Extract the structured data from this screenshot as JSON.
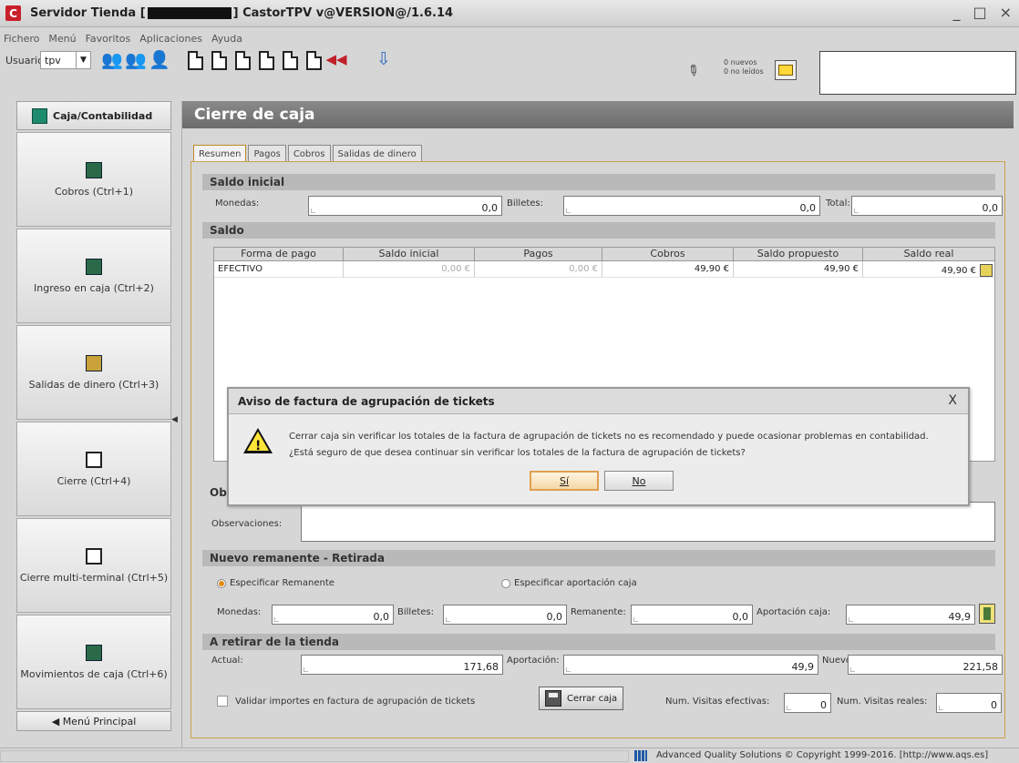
{
  "window": {
    "title_prefix": "Servidor Tienda [",
    "title_suffix": "] CastorTPV v@VERSION@/1.6.14",
    "controls": {
      "minimize": "_",
      "maximize": "□",
      "close": "×"
    }
  },
  "menu": [
    "Fichero",
    "Menú",
    "Favoritos",
    "Aplicaciones",
    "Ayuda"
  ],
  "toolbar": {
    "user_label": "Usuario:",
    "user_value": "tpv",
    "messages_line1": "0 nuevos",
    "messages_line2": "0 no leídos"
  },
  "sidebar": {
    "header": "Caja/Contabilidad",
    "items": [
      {
        "label": "Cobros (Ctrl+1)"
      },
      {
        "label": "Ingreso en caja (Ctrl+2)"
      },
      {
        "label": "Salidas de dinero (Ctrl+3)"
      },
      {
        "label": "Cierre (Ctrl+4)"
      },
      {
        "label": "Cierre multi-terminal (Ctrl+5)"
      },
      {
        "label": "Movimientos de caja (Ctrl+6)"
      }
    ],
    "footer": "◀ Menú Principal"
  },
  "main": {
    "title": "Cierre de caja",
    "tabs": [
      "Resumen",
      "Pagos",
      "Cobros",
      "Salidas de dinero"
    ],
    "saldo_inicial": {
      "heading": "Saldo inicial",
      "monedas_label": "Monedas:",
      "monedas_value": "0,0",
      "billetes_label": "Billetes:",
      "billetes_value": "0,0",
      "total_label": "Total:",
      "total_value": "0,0"
    },
    "saldo": {
      "heading": "Saldo",
      "columns": [
        "Forma de pago",
        "Saldo inicial",
        "Pagos",
        "Cobros",
        "Saldo propuesto",
        "Saldo real"
      ],
      "rows": [
        {
          "forma": "EFECTIVO",
          "saldo_inicial": "0,00 €",
          "pagos": "0,00 €",
          "cobros": "49,90 €",
          "propuesto": "49,90 €",
          "real": "49,90 €"
        }
      ]
    },
    "observaciones": {
      "heading_partial": "Ob",
      "label": "Observaciones:"
    },
    "remanente": {
      "heading": "Nuevo remanente - Retirada",
      "opt1": "Especificar Remanente",
      "opt2": "Especificar aportación caja",
      "monedas_label": "Monedas:",
      "monedas_value": "0,0",
      "billetes_label": "Billetes:",
      "billetes_value": "0,0",
      "remanente_label": "Remanente:",
      "remanente_value": "0,0",
      "aportacion_label": "Aportación caja:",
      "aportacion_value": "49,9"
    },
    "retirar": {
      "heading": "A retirar de la tienda",
      "actual_label": "Actual:",
      "actual_value": "171,68",
      "aportacion_label": "Aportación:",
      "aportacion_value": "49,9",
      "nuevo_label": "Nuevo:",
      "nuevo_value": "221,58"
    },
    "bottom": {
      "validar_label": "Validar importes en factura de agrupación de tickets",
      "cerrar_button": "Cerrar caja",
      "visitas_efectivas_label": "Num. Visitas efectivas:",
      "visitas_efectivas_value": "0",
      "visitas_reales_label": "Num. Visitas reales:",
      "visitas_reales_value": "0"
    }
  },
  "dialog": {
    "title": "Aviso de factura de agrupación de tickets",
    "close": "X",
    "message_line1": "Cerrar caja sin verificar los totales de la factura de agrupación de tickets no es recomendado y puede ocasionar problemas en contabilidad.",
    "message_line2": "¿Está seguro de que desea continuar sin verificar los totales de la factura de agrupación de tickets?",
    "yes": "Sí",
    "no": "No"
  },
  "status": {
    "text": "Advanced Quality Solutions © Copyright 1999-2016. [http://www.aqs.es]"
  },
  "colors": {
    "accent_tab": "#c08a2a",
    "dialog_primary": "#e0a050",
    "title_panel": "#7a7a7a"
  }
}
